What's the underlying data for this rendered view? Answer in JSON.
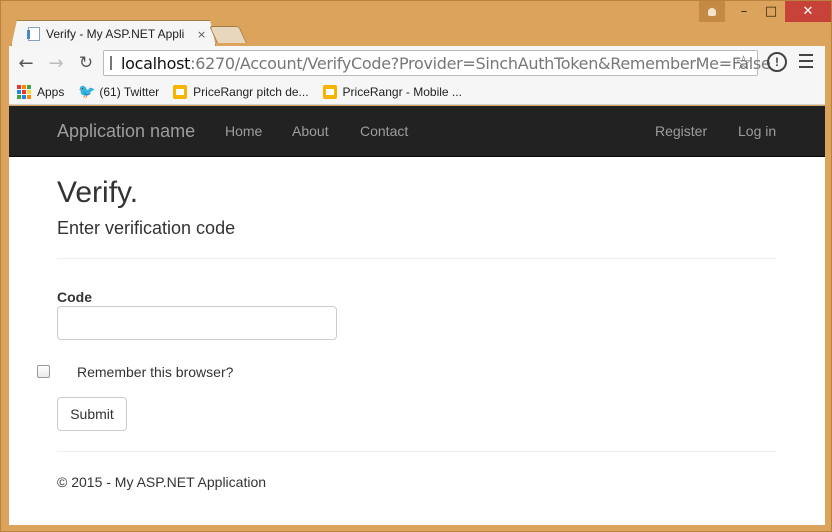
{
  "browser": {
    "tab_title": "Verify - My ASP.NET Appli",
    "tab_close": "×",
    "url_host": "localhost",
    "url_path": ":6270/Account/VerifyCode?Provider=SinchAuthToken&RememberMe=False",
    "window_controls": {
      "minimize": "–",
      "maximize": "□",
      "close": "✕"
    },
    "bookmarks": [
      {
        "label": "Apps",
        "icon": "apps-icon"
      },
      {
        "label": "(61) Twitter",
        "icon": "twitter-icon"
      },
      {
        "label": "PriceRangr pitch de...",
        "icon": "slides-icon"
      },
      {
        "label": "PriceRangr - Mobile ...",
        "icon": "slides-icon"
      }
    ]
  },
  "navbar": {
    "brand": "Application name",
    "links": [
      "Home",
      "About",
      "Contact"
    ],
    "right_links": [
      "Register",
      "Log in"
    ]
  },
  "page": {
    "title": "Verify.",
    "subtitle": "Enter verification code",
    "code_label": "Code",
    "code_value": "",
    "remember_label": "Remember this browser?",
    "remember_checked": false,
    "submit_label": "Submit",
    "footer": "© 2015 - My ASP.NET Application"
  },
  "colors": {
    "frame": "#dba35c",
    "navbar": "#222222",
    "navlink": "#9d9d9d",
    "close_button": "#c7433a"
  }
}
